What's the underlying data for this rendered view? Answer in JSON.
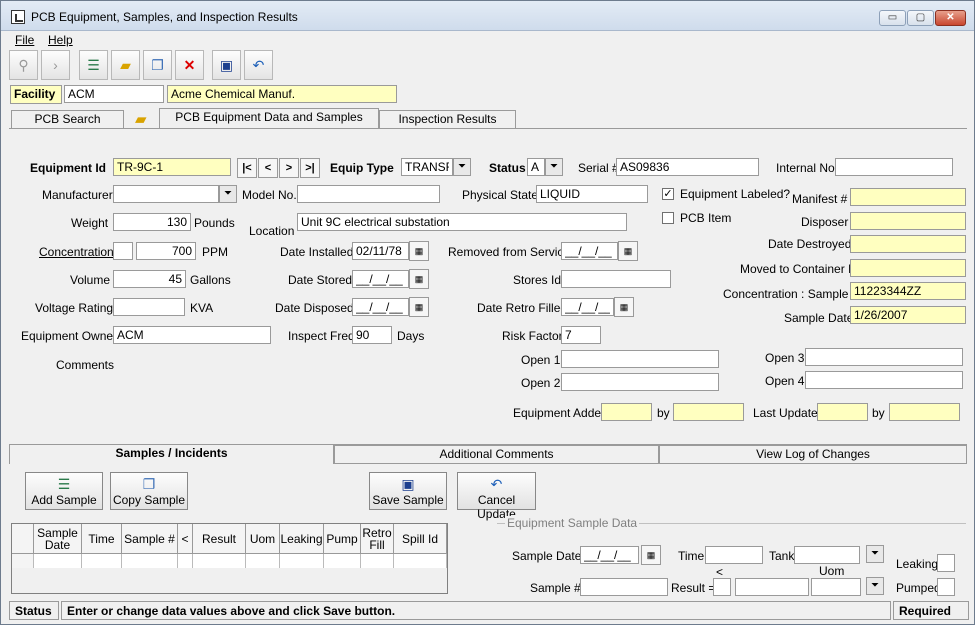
{
  "window": {
    "title": "PCB Equipment, Samples, and Inspection Results",
    "min": "▭",
    "max": "▢",
    "close": "✕"
  },
  "menu": {
    "file": "File",
    "help": "Help"
  },
  "toolbar": {
    "icons": [
      "binoculars-icon",
      "arrow-icon",
      "database-icon",
      "folder-open-icon",
      "copy-icon",
      "delete-icon",
      "save-icon",
      "undo-icon"
    ]
  },
  "facility": {
    "label": "Facility",
    "code": "ACM",
    "name": "Acme Chemical Manuf."
  },
  "tabs": {
    "search": "PCB Search",
    "equipment": "PCB Equipment Data and Samples",
    "inspection": "Inspection Results"
  },
  "equipment": {
    "id_label": "Equipment Id",
    "id": "TR-9C-1",
    "nav": [
      "|<",
      "<",
      ">",
      ">|"
    ],
    "type_label": "Equip Type",
    "type": "TRANSF",
    "status_label": "Status",
    "status": "A",
    "serial_label": "Serial #",
    "serial": "AS09836",
    "internal_label": "Internal No",
    "internal": "",
    "manufacturer_label": "Manufacturer",
    "manufacturer": "",
    "model_label": "Model No.",
    "model": "",
    "physical_label": "Physical State",
    "physical": "LIQUID",
    "labeled_label": "Equipment Labeled?",
    "labeled_check": "✓",
    "pcb_item_label": "PCB Item",
    "manifest_label": "Manifest #",
    "manifest": "",
    "weight_label": "Weight",
    "weight": "130",
    "weight_unit": "Pounds",
    "location_label": "Location",
    "location": "Unit 9C electrical substation",
    "disposer_label": "Disposer",
    "disposer": "",
    "conc_label": "Concentration",
    "conc_prefix": "",
    "conc": "700",
    "conc_unit": "PPM",
    "installed_label": "Date Installed",
    "installed": "02/11/78",
    "removed_label": "Removed from Service",
    "removed": "__/__/__",
    "destroyed_label": "Date Destroyed",
    "destroyed": "",
    "volume_label": "Volume",
    "volume": "45",
    "volume_unit": "Gallons",
    "stored_label": "Date Stored",
    "stored": "__/__/__",
    "stores_label": "Stores Id",
    "stores": "",
    "moved_label": "Moved to Container Id",
    "moved": "",
    "voltage_label": "Voltage Rating",
    "voltage": "",
    "voltage_unit": "KVA",
    "disposed_label": "Date Disposed",
    "disposed": "__/__/__",
    "retro_label": "Date Retro Filled",
    "retro": "__/__/__",
    "conc_sample_label": "Concentration : Sample Id",
    "conc_sample": "11223344ZZ",
    "owner_label": "Equipment Owner",
    "owner": "ACM",
    "inspect_label": "Inspect Freq",
    "inspect": "90",
    "inspect_unit": "Days",
    "risk_label": "Risk Factor",
    "risk": "7",
    "sample_date_label": "Sample Date",
    "sample_date": "1/26/2007",
    "comments_label": "Comments",
    "comments": "",
    "open1_label": "Open 1",
    "open1": "",
    "open2_label": "Open 2",
    "open2": "",
    "open3_label": "Open 3",
    "open3": "",
    "open4_label": "Open 4",
    "open4": "",
    "added_label": "Equipment Added",
    "added": "",
    "by_label": "by",
    "added_by": "",
    "last_update_label": "Last Update",
    "last_update": "",
    "last_by": ""
  },
  "subtabs": {
    "samples": "Samples  / Incidents",
    "additional": "Additional Comments",
    "log": "View Log of Changes"
  },
  "buttons": {
    "add_sample": "Add Sample",
    "copy_sample": "Copy Sample",
    "save_sample": "Save Sample",
    "cancel_update": "Cancel Update"
  },
  "grid": {
    "headers": [
      "Sample Date",
      "Time",
      "Sample #",
      "<",
      "Result",
      "Uom",
      "Leaking",
      "Pump",
      "Retro Fill",
      "Spill Id"
    ]
  },
  "sample_panel": {
    "title": "Equipment Sample Data",
    "date_label": "Sample Date",
    "date": "__/__/__",
    "time_label": "Time",
    "time": "",
    "tank_label": "Tank",
    "tank": "",
    "leaking_label": "Leaking",
    "number_label": "Sample #",
    "number": "",
    "result_label": "Result =",
    "lt": "<",
    "result": "",
    "uom_label": "Uom",
    "uom": "",
    "pumped_label": "Pumped"
  },
  "status": {
    "label": "Status",
    "message": "Enter or change data values above and click Save button.",
    "required": "Required"
  }
}
